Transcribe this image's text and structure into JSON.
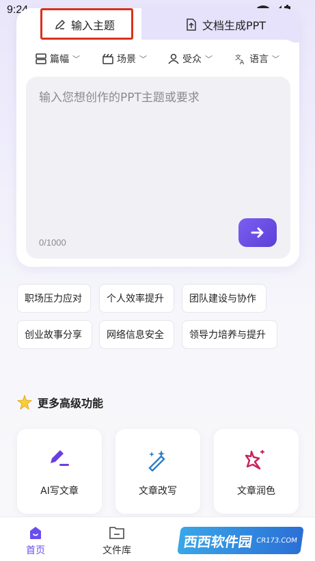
{
  "status_bar": {
    "time": "9:24"
  },
  "tabs": {
    "input_topic": "输入主题",
    "doc_generate": "文档生成PPT"
  },
  "options": [
    {
      "label": "篇幅",
      "icon": "layout-icon"
    },
    {
      "label": "场景",
      "icon": "scene-icon"
    },
    {
      "label": "受众",
      "icon": "audience-icon"
    },
    {
      "label": "语言",
      "icon": "language-icon"
    }
  ],
  "topic_input": {
    "placeholder": "输入您想创作的PPT主题或要求",
    "counter": "0/1000"
  },
  "suggestions": [
    "职场压力应对",
    "个人效率提升",
    "团队建设与协作",
    "创业故事分享",
    "网络信息安全",
    "领导力培养与提升"
  ],
  "features": {
    "title": "更多高级功能",
    "items": [
      {
        "label": "AI写文章",
        "icon": "pen-write-icon",
        "color": "#6a3ee0"
      },
      {
        "label": "文章改写",
        "icon": "magic-wand-icon",
        "color": "#2f7fc8"
      },
      {
        "label": "文章润色",
        "icon": "sparkle-icon",
        "color": "#c8245a"
      }
    ]
  },
  "bottom_nav": {
    "home": "首页",
    "files": "文件库"
  },
  "watermark": {
    "text": "西西软件园",
    "sub": "CR173.COM"
  },
  "colors": {
    "accent": "#6a4df0",
    "highlight_border": "#d9301e"
  }
}
